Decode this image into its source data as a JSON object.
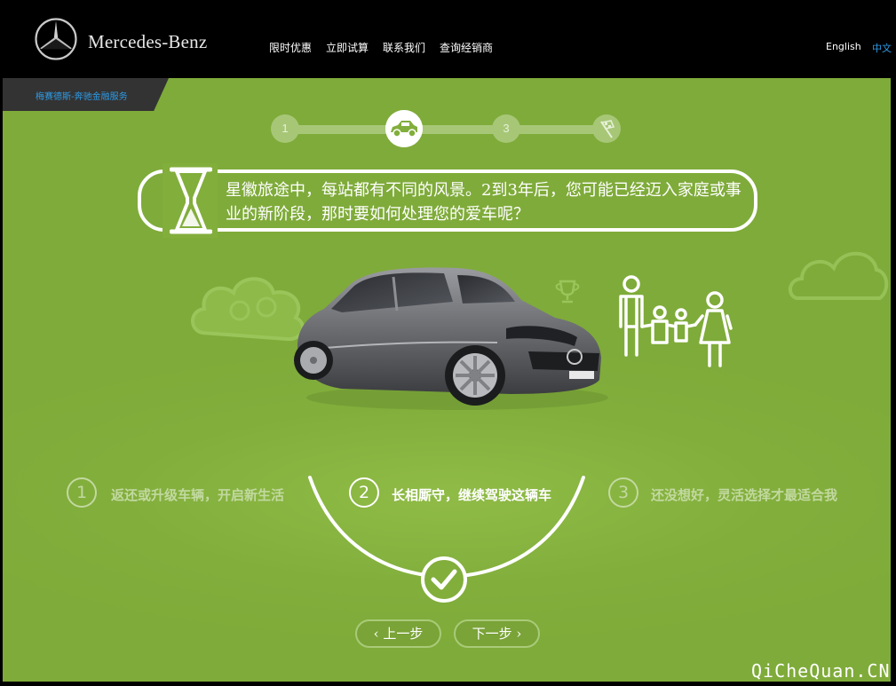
{
  "header": {
    "brand": "Mercedes-Benz",
    "nav": [
      "限时优惠",
      "立即试算",
      "联系我们",
      "查询经销商"
    ],
    "languages": [
      {
        "label": "English",
        "active": false,
        "color": "#ffffff"
      },
      {
        "label": "中文",
        "active": true,
        "color": "#2e9be6"
      }
    ]
  },
  "breadcrumb": {
    "label": "梅赛德斯-奔驰金融服务"
  },
  "progress": {
    "steps": [
      "1",
      "car-icon",
      "3",
      "checkered-flag-icon"
    ],
    "current_step": 2
  },
  "question": {
    "text": "星徽旅途中，每站都有不同的风景。2到3年后，您可能已经迈入家庭或事业的新阶段，那时要如何处理您的爱车呢？",
    "icon": "hourglass-icon"
  },
  "illustration": {
    "icons": [
      "car-image",
      "family-icon",
      "cloud-icon",
      "trophy-icon"
    ]
  },
  "options": [
    {
      "number": "1",
      "label": "返还或升级车辆，开启新生活",
      "selected": false
    },
    {
      "number": "2",
      "label": "长相厮守，继续驾驶这辆车",
      "selected": true
    },
    {
      "number": "3",
      "label": "还没想好，灵活选择才最适合我",
      "selected": false
    }
  ],
  "buttons": {
    "prev": "上一步",
    "next": "下一步"
  },
  "watermark": "QiCheQuan.CN",
  "colors": {
    "background_green": "#82ae3c",
    "header": "#000000",
    "link_blue": "#2e9be6",
    "breadcrumb_bg": "#333333"
  }
}
